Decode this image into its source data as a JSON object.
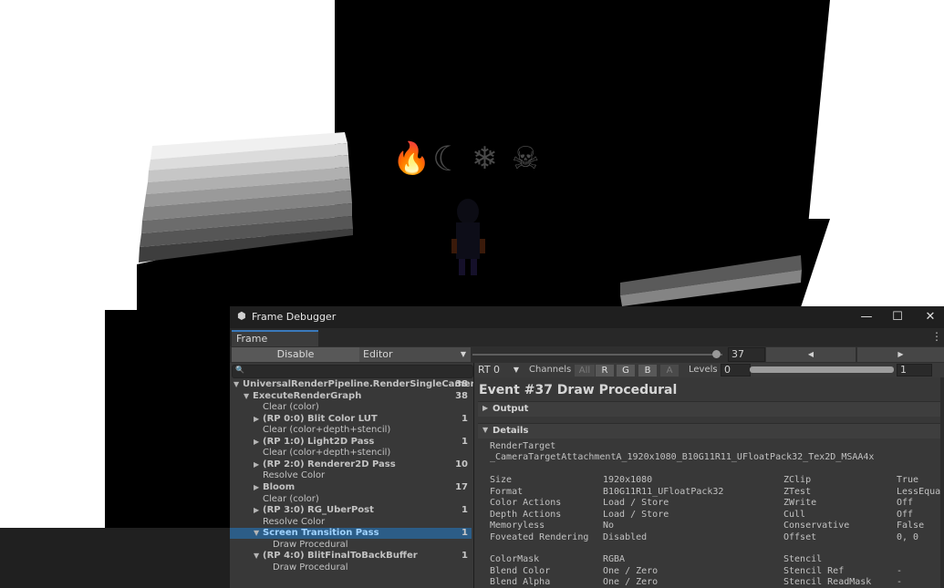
{
  "window": {
    "title": "Frame Debugger",
    "tab_label": "Frame Debugger",
    "controls": {
      "minimize": "—",
      "maximize": "☐",
      "close": "✕"
    }
  },
  "toolbar": {
    "disable_label": "Disable",
    "target_dropdown": "Editor",
    "event_value": "37",
    "prev_label": "◀",
    "next_label": "▶"
  },
  "render_target_bar": {
    "rt_dropdown": "RT 0",
    "channels_label": "Channels",
    "channels": [
      "All",
      "R",
      "G",
      "B",
      "A"
    ],
    "levels_label": "Levels",
    "levels_min": "0",
    "levels_max": "1"
  },
  "tree": [
    {
      "label": "UniversalRenderPipeline.RenderSingleCameraInte",
      "count": "38",
      "bold": true,
      "indent": 0,
      "arrow": "▼"
    },
    {
      "label": "ExecuteRenderGraph",
      "count": "38",
      "bold": true,
      "indent": 1,
      "arrow": "▼"
    },
    {
      "label": "Clear (color)",
      "count": "",
      "bold": false,
      "indent": 2,
      "arrow": ""
    },
    {
      "label": "(RP 0:0) Blit Color LUT",
      "count": "1",
      "bold": true,
      "indent": 2,
      "arrow": "▶"
    },
    {
      "label": "Clear (color+depth+stencil)",
      "count": "",
      "bold": false,
      "indent": 2,
      "arrow": ""
    },
    {
      "label": "(RP 1:0) Light2D Pass",
      "count": "1",
      "bold": true,
      "indent": 2,
      "arrow": "▶"
    },
    {
      "label": "Clear (color+depth+stencil)",
      "count": "",
      "bold": false,
      "indent": 2,
      "arrow": ""
    },
    {
      "label": "(RP 2:0) Renderer2D Pass",
      "count": "10",
      "bold": true,
      "indent": 2,
      "arrow": "▶"
    },
    {
      "label": "Resolve Color",
      "count": "",
      "bold": false,
      "indent": 2,
      "arrow": ""
    },
    {
      "label": "Bloom",
      "count": "17",
      "bold": true,
      "indent": 2,
      "arrow": "▶"
    },
    {
      "label": "Clear (color)",
      "count": "",
      "bold": false,
      "indent": 2,
      "arrow": ""
    },
    {
      "label": "(RP 3:0) RG_UberPost",
      "count": "1",
      "bold": true,
      "indent": 2,
      "arrow": "▶"
    },
    {
      "label": "Resolve Color",
      "count": "",
      "bold": false,
      "indent": 2,
      "arrow": ""
    },
    {
      "label": "Screen Transition Pass",
      "count": "1",
      "bold": true,
      "indent": 2,
      "arrow": "▼",
      "selected": true
    },
    {
      "label": "Draw Procedural",
      "count": "",
      "bold": false,
      "indent": 3,
      "arrow": ""
    },
    {
      "label": "(RP 4:0) BlitFinalToBackBuffer",
      "count": "1",
      "bold": true,
      "indent": 2,
      "arrow": "▼"
    },
    {
      "label": "Draw Procedural",
      "count": "",
      "bold": false,
      "indent": 3,
      "arrow": ""
    }
  ],
  "event": {
    "title": "Event #37 Draw Procedural",
    "output_label": "Output",
    "details_label": "Details",
    "render_target_label": "RenderTarget",
    "render_target_value": "_CameraTargetAttachmentA_1920x1080_B10G11R11_UFloatPack32_Tex2D_MSAA4x",
    "props_left": [
      {
        "k": "Size",
        "v": "1920x1080"
      },
      {
        "k": "Format",
        "v": "B10G11R11_UFloatPack32"
      },
      {
        "k": "Color Actions",
        "v": "Load / Store"
      },
      {
        "k": "Depth Actions",
        "v": "Load / Store"
      },
      {
        "k": "Memoryless",
        "v": "No"
      },
      {
        "k": "Foveated Rendering",
        "v": "Disabled"
      }
    ],
    "props_right": [
      {
        "k": "ZClip",
        "v": "True"
      },
      {
        "k": "ZTest",
        "v": "LessEqua"
      },
      {
        "k": "ZWrite",
        "v": "Off"
      },
      {
        "k": "Cull",
        "v": "Off"
      },
      {
        "k": "Conservative",
        "v": "False"
      },
      {
        "k": "Offset",
        "v": "0, 0"
      }
    ],
    "props_left2": [
      {
        "k": "ColorMask",
        "v": "RGBA"
      },
      {
        "k": "Blend Color",
        "v": "One / Zero"
      },
      {
        "k": "Blend Alpha",
        "v": "One / Zero"
      }
    ],
    "props_right2": [
      {
        "k": "Stencil",
        "v": ""
      },
      {
        "k": "Stencil Ref",
        "v": "-"
      },
      {
        "k": "Stencil ReadMask",
        "v": "-"
      }
    ]
  },
  "scene": {
    "icons": [
      "fire-icon",
      "moon-icon",
      "snowflake-icon",
      "skull-icon"
    ],
    "icon_glyphs": [
      "🔥",
      "☾",
      "❄",
      "☠"
    ]
  }
}
